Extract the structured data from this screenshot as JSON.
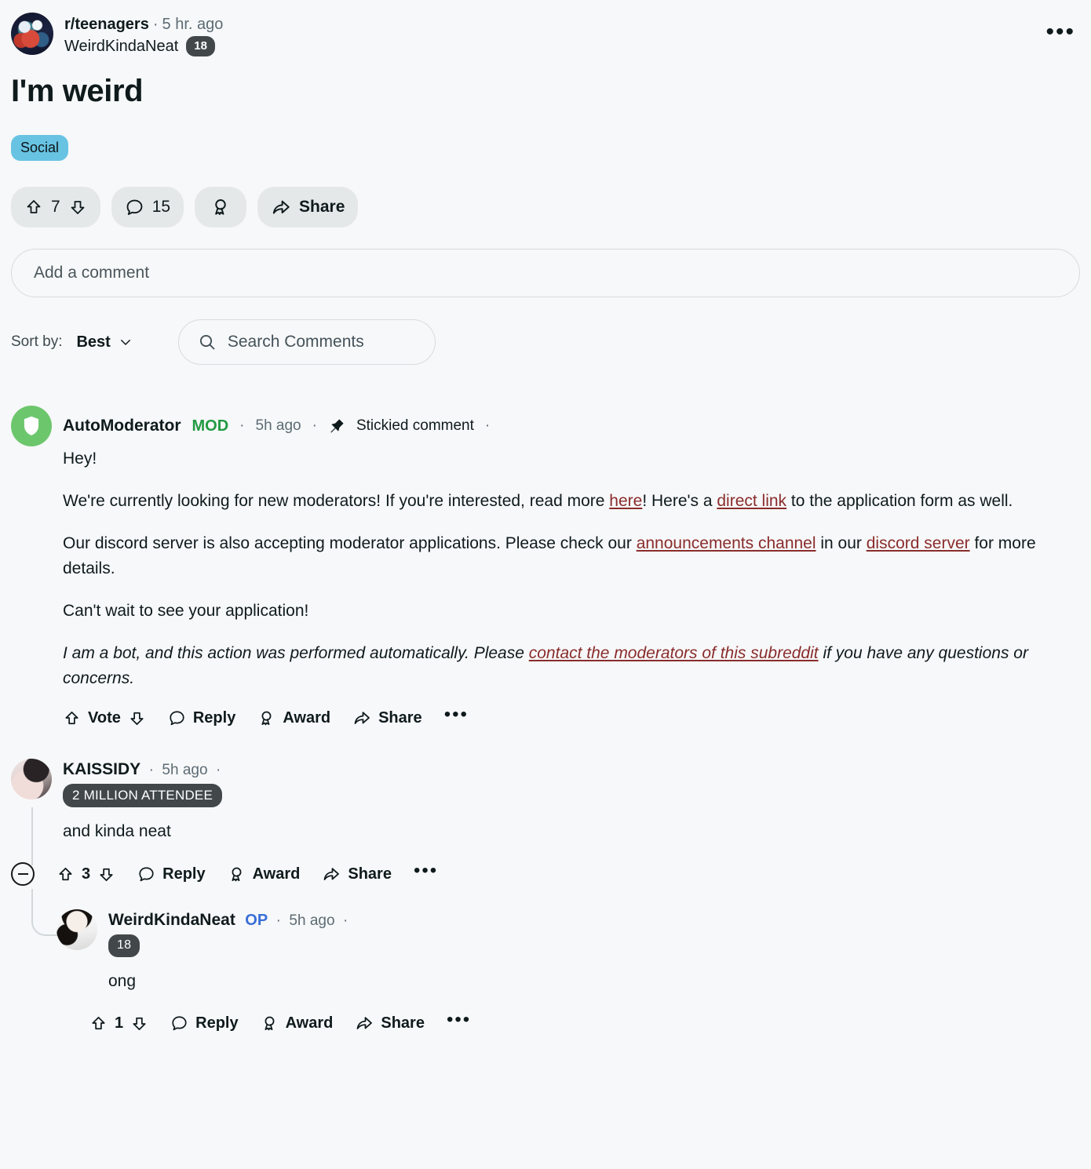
{
  "post": {
    "subreddit": "r/teenagers",
    "separator": "·",
    "time": "5 hr. ago",
    "author": "WeirdKindaNeat",
    "author_age_badge": "18",
    "title": "I'm weird",
    "flair": "Social",
    "overflow_icon": "•••",
    "avatar_icon": "subreddit-avatar"
  },
  "post_actions": {
    "upvote_icon": "upvote-arrow-icon",
    "score": "7",
    "downvote_icon": "downvote-arrow-icon",
    "comment_icon": "comment-bubble-icon",
    "comment_count": "15",
    "award_icon": "award-rosette-icon",
    "share_icon": "share-arrow-icon",
    "share_label": "Share"
  },
  "composer": {
    "placeholder": "Add a comment"
  },
  "sort": {
    "label": "Sort by:",
    "value": "Best",
    "chevron_icon": "chevron-down-icon",
    "search_icon": "search-icon",
    "search_placeholder": "Search Comments"
  },
  "comments": [
    {
      "author": "AutoModerator",
      "mod_tag": "MOD",
      "time": "5h ago",
      "sticky_icon": "pin-icon",
      "sticky_label": "Stickied comment",
      "dot": "·",
      "avatar_icon": "shield-icon",
      "paragraphs": [
        {
          "id": "p1",
          "text": "Hey!"
        }
      ],
      "p2_a": "We're currently looking for new moderators! If you're interested, read more ",
      "p2_link1": "here",
      "p2_b": "! Here's a ",
      "p2_link2": "direct link",
      "p2_c": " to the application form as well.",
      "p3_a": "Our discord server is also accepting moderator applications. Please check our ",
      "p3_link1": "announcements channel",
      "p3_b": " in our ",
      "p3_link2": "discord server",
      "p3_c": " for more details.",
      "p4": "Can't wait to see your application!",
      "p5_a": "I am a bot, and this action was performed automatically. Please ",
      "p5_link": "contact the moderators of this subreddit",
      "p5_b": " if you have any questions or concerns.",
      "actions": {
        "vote_label": "Vote",
        "reply_label": "Reply",
        "award_label": "Award",
        "share_label": "Share",
        "overflow": "•••"
      }
    }
  ],
  "comment2": {
    "author": "KAISSIDY",
    "dot": "·",
    "time": "5h ago",
    "dot2": "·",
    "badge": "2 MILLION ATTENDEE",
    "body": "and kinda neat",
    "avatar_icon": "user-avatar",
    "collapse_icon": "collapse-minus-icon",
    "actions": {
      "score": "3",
      "reply_label": "Reply",
      "award_label": "Award",
      "share_label": "Share",
      "overflow": "•••"
    }
  },
  "reply": {
    "author": "WeirdKindaNeat",
    "op_tag": "OP",
    "dot": "·",
    "time": "5h ago",
    "dot2": "·",
    "badge": "18",
    "body": "ong",
    "avatar_icon": "user-avatar",
    "actions": {
      "score": "1",
      "reply_label": "Reply",
      "award_label": "Award",
      "share_label": "Share",
      "overflow": "•••"
    }
  },
  "colors": {
    "background": "#f7f8f9",
    "pill_bg": "#e5e8e9",
    "flair_bg": "#68c3e3",
    "link": "#8a2c2c",
    "mod_green": "#229a44",
    "op_blue": "#3a6fd8",
    "badge_dark": "#42484a",
    "automod_avatar": "#6cc76c",
    "muted_text": "#5c6c74"
  }
}
